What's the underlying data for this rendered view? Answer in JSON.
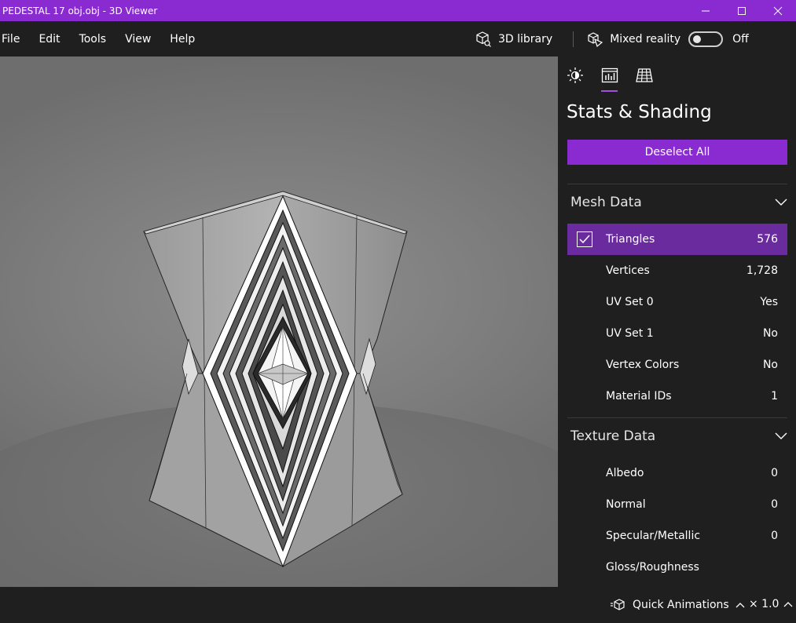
{
  "window": {
    "title": "PEDESTAL 17 obj.obj - 3D Viewer"
  },
  "menu": {
    "items": [
      "File",
      "Edit",
      "Tools",
      "View",
      "Help"
    ],
    "library_label": "3D library",
    "mixed_reality_label": "Mixed reality",
    "toggle_state": "Off"
  },
  "panel": {
    "title": "Stats & Shading",
    "deselect_label": "Deselect All",
    "mesh_section": "Mesh Data",
    "mesh_rows": [
      {
        "label": "Triangles",
        "value": "576"
      },
      {
        "label": "Vertices",
        "value": "1,728"
      },
      {
        "label": "UV Set 0",
        "value": "Yes"
      },
      {
        "label": "UV Set 1",
        "value": "No"
      },
      {
        "label": "Vertex Colors",
        "value": "No"
      },
      {
        "label": "Material IDs",
        "value": "1"
      }
    ],
    "texture_section": "Texture Data",
    "texture_rows": [
      {
        "label": "Albedo",
        "value": "0"
      },
      {
        "label": "Normal",
        "value": "0"
      },
      {
        "label": "Specular/Metallic",
        "value": "0"
      },
      {
        "label": "Gloss/Roughness",
        "value": ""
      }
    ]
  },
  "status": {
    "quick_animations_label": "Quick Animations",
    "speed_label": "× 1.0"
  },
  "colors": {
    "accent": "#8a2bd2",
    "selected_row": "#6a2b9e",
    "background": "#1f1f1f"
  },
  "icons": {
    "minimize": "minimize-icon",
    "maximize": "maximize-icon",
    "close": "close-icon",
    "library": "cube-library-icon",
    "mixed_reality": "mixed-reality-icon",
    "lighting_tab": "sun-icon",
    "stats_tab": "stats-chart-icon",
    "grid_tab": "grid-icon",
    "collapse": "chevron-down-icon",
    "check": "check-icon",
    "quick_animations": "animation-cube-icon",
    "expand": "chevron-up-icon"
  }
}
